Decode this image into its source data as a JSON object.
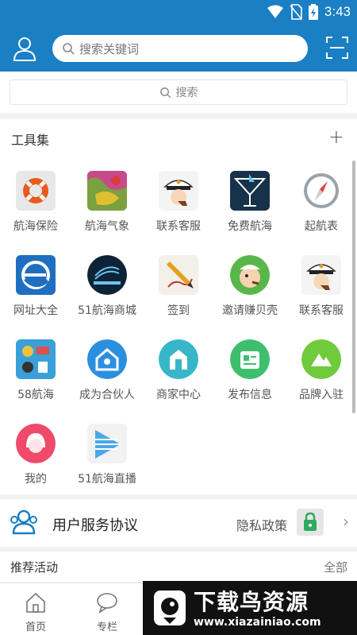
{
  "status_bar": {
    "time": "3:43"
  },
  "header": {
    "search_placeholder": "搜索关键词"
  },
  "subsearch": {
    "placeholder": "搜索"
  },
  "tools": {
    "title": "工具集",
    "add_label": "+",
    "items": [
      {
        "label": "航海保险",
        "icon": "insurance-lifebuoy-icon"
      },
      {
        "label": "航海气象",
        "icon": "weather-map-icon"
      },
      {
        "label": "联系客服",
        "icon": "captain-service-icon"
      },
      {
        "label": "免费航海",
        "icon": "cocktail-sail-icon"
      },
      {
        "label": "起航表",
        "icon": "compass-icon"
      },
      {
        "label": "网址大全",
        "icon": "browser-e-icon"
      },
      {
        "label": "51航海商城",
        "icon": "mall-logo-icon"
      },
      {
        "label": "签到",
        "icon": "pencil-signin-icon"
      },
      {
        "label": "邀请赚贝壳",
        "icon": "popeye-invite-icon"
      },
      {
        "label": "联系客服",
        "icon": "captain-service-icon"
      },
      {
        "label": "58航海",
        "icon": "marine-tools-icon"
      },
      {
        "label": "成为合伙人",
        "icon": "partner-house-icon"
      },
      {
        "label": "商家中心",
        "icon": "merchant-center-icon"
      },
      {
        "label": "发布信息",
        "icon": "publish-info-icon"
      },
      {
        "label": "品牌入驻",
        "icon": "brand-mountain-icon"
      },
      {
        "label": "我的",
        "icon": "avatar-girl-icon"
      },
      {
        "label": "51航海直播",
        "icon": "live-stream-icon"
      }
    ]
  },
  "agreement": {
    "title": "用户服务协议",
    "privacy": "隐私政策"
  },
  "recommend": {
    "title": "推荐活动",
    "all": "全部"
  },
  "tabbar": {
    "tabs": [
      {
        "label": "首页"
      },
      {
        "label": "专栏"
      }
    ]
  },
  "watermark": {
    "title": "下载鸟资源",
    "url": "www.xiazainiao.com"
  },
  "colors": {
    "primary": "#1a7fc3",
    "background": "#f2f2f2"
  }
}
